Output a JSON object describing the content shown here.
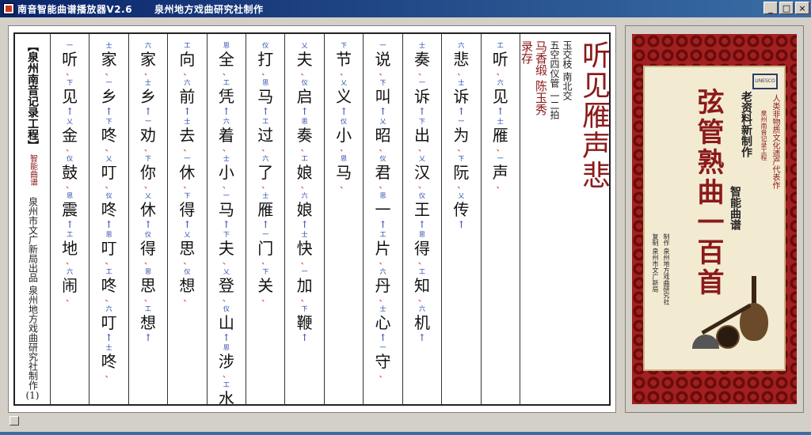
{
  "window": {
    "title": "南音智能曲谱播放器V2.6",
    "subtitle": "泉州地方戏曲研究社制作",
    "buttons": [
      "_",
      "□",
      "×"
    ]
  },
  "label_col": {
    "project": "【泉州南音记录工程】",
    "smart": "智能曲谱",
    "publisher": "泉州市文广新局出品 泉州地方戏曲研究社制作",
    "page": "(1)"
  },
  "song": {
    "title": "听见雁声悲",
    "meta1": "玉交枝 南北交",
    "meta2": "五空四仪管 一二拍",
    "singer": "马香缎 陈玉秀",
    "record": "录存"
  },
  "columns": [
    {
      "lyrics": [
        "听",
        "见",
        "雁",
        "声"
      ]
    },
    {
      "lyrics": [
        "悲",
        "诉",
        "为",
        "阮",
        "传"
      ]
    },
    {
      "lyrics": [
        "奏",
        "诉",
        "出",
        "汉",
        "王",
        "得",
        "知",
        "机"
      ]
    },
    {
      "lyrics": [
        "说",
        "叫",
        "昭",
        "君",
        "一",
        "片",
        "丹",
        "心",
        "守"
      ]
    },
    {
      "lyrics": [
        "节",
        "义",
        "小",
        "马"
      ]
    },
    {
      "lyrics": [
        "夫",
        "启",
        "奏",
        "娘",
        "娘",
        "快",
        "加",
        "鞭"
      ]
    },
    {
      "lyrics": [
        "打",
        "马",
        "过",
        "了",
        "雁",
        "门",
        "关"
      ]
    },
    {
      "lyrics": [
        "全",
        "凭",
        "着",
        "小",
        "马",
        "夫",
        "登",
        "山",
        "涉",
        "水"
      ]
    },
    {
      "lyrics": [
        "向",
        "前",
        "去",
        "休",
        "得",
        "思",
        "想"
      ]
    },
    {
      "lyrics": [
        "家",
        "乡",
        "劝",
        "你",
        "休",
        "得",
        "思",
        "想"
      ]
    },
    {
      "lyrics": [
        "家",
        "乡",
        "咚",
        "叮",
        "咚",
        "叮",
        "咚",
        "叮",
        "咚"
      ]
    },
    {
      "lyrics": [
        "听",
        "见",
        "金",
        "鼓",
        "震",
        "地",
        "闹"
      ]
    }
  ],
  "poster": {
    "badge": "UNESCO",
    "heritage": "人类非物质文化遗产代表作",
    "project": "泉州南音记录工程",
    "old_new": "老资料新制作",
    "smart": "智能曲谱",
    "big_title": "弦管熟曲一百首",
    "credit1": "制作 泉州地方戏曲研究社",
    "credit2": "复制 泉州市文广新局"
  },
  "colors": {
    "title_bar_start": "#0a246a",
    "title_bar_end": "#3a6ea5",
    "song_title": "#8b1a1a",
    "notation_blue": "#1f3fa8",
    "mark_red": "#d01010",
    "poster_red": "#7a1010"
  }
}
